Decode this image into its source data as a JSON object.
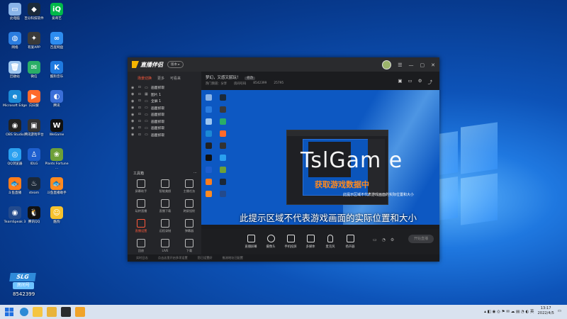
{
  "desktop": {
    "icons": [
      {
        "label": "此电脑",
        "color": "#8ab4e8",
        "glyph": "▭"
      },
      {
        "label": "百分科技软件",
        "color": "#1b2a3a",
        "glyph": "◆"
      },
      {
        "label": "爱奇艺",
        "color": "#00b84a",
        "glyph": "iQ"
      },
      {
        "label": "网络",
        "color": "#2b7de0",
        "glyph": "◍"
      },
      {
        "label": "有爱APP",
        "color": "#3a3a3a",
        "glyph": "✦"
      },
      {
        "label": "百度网盘",
        "color": "#2d8cf0",
        "glyph": "∞"
      },
      {
        "label": "回收站",
        "color": "#9ec6f0",
        "glyph": "🗑"
      },
      {
        "label": "微信",
        "color": "#2aae67",
        "glyph": "✉"
      },
      {
        "label": "酷狗音乐",
        "color": "#1f7ae0",
        "glyph": "K"
      },
      {
        "label": "Microsoft Edge",
        "color": "#1b8ad6",
        "glyph": "e"
      },
      {
        "label": "向日葵",
        "color": "#ff6a2b",
        "glyph": "▶"
      },
      {
        "label": "腾讯",
        "color": "#3b6fd8",
        "glyph": "◐"
      },
      {
        "label": "OBS Studio",
        "color": "#222",
        "glyph": "◉"
      },
      {
        "label": "腾讯游戏平台",
        "color": "#333",
        "glyph": "▣"
      },
      {
        "label": "WeGame",
        "color": "#111",
        "glyph": "W"
      },
      {
        "label": "QQ浏览器",
        "color": "#2aa0f0",
        "glyph": "◎"
      },
      {
        "label": "IDLG",
        "color": "#1e5fcf",
        "glyph": "♙"
      },
      {
        "label": "Plants Fortune ...",
        "color": "#6ea038",
        "glyph": "❀"
      },
      {
        "label": "斗鱼直播",
        "color": "#ff7d1a",
        "glyph": "🐟"
      },
      {
        "label": "steam",
        "color": "#1b2838",
        "glyph": "♨"
      },
      {
        "label": "斗鱼直播助手",
        "color": "#ff8a1f",
        "glyph": "🐟"
      },
      {
        "label": "TeamSpeak 3",
        "color": "#234a8c",
        "glyph": "◉"
      },
      {
        "label": "腾讯QQ",
        "color": "#111",
        "glyph": "🐧"
      },
      {
        "label": "酷狗",
        "color": "#f6c22d",
        "glyph": "☺"
      }
    ]
  },
  "app": {
    "title": "直播伴侣",
    "version_label": "版本 ▸",
    "left_tabs": [
      "场景切换",
      "更多",
      "可看来"
    ],
    "scenes": [
      {
        "name": "画面抓取"
      },
      {
        "name": "图片 1"
      },
      {
        "name": "全屏 1"
      },
      {
        "name": "画面抓取"
      },
      {
        "name": "画面抓取"
      },
      {
        "name": "画面抓取"
      },
      {
        "name": "画面抓取"
      },
      {
        "name": "画面抓取"
      }
    ],
    "toolbox_label": "工具箱",
    "tools": [
      {
        "label": "屏幕助手"
      },
      {
        "label": "智能美颜"
      },
      {
        "label": "主播任务"
      },
      {
        "label": "玩转直播"
      },
      {
        "label": "直播下载"
      },
      {
        "label": "跨屏投射"
      },
      {
        "label": "直播设置"
      },
      {
        "label": "远程录制"
      },
      {
        "label": "弹幕器"
      },
      {
        "label": "回放"
      },
      {
        "label": "LIVE"
      },
      {
        "label": "下载"
      }
    ],
    "room_title": "梦幻，又感又腻玩！",
    "edit_label": "修改",
    "room_meta": [
      "热门频道：分享",
      "房间号码",
      "8542399",
      "25795"
    ],
    "bottom_buttons": [
      "直播屏幕",
      "摄像头",
      "手机投屏",
      "多媒体",
      "麦克风",
      "扬声器"
    ],
    "start_live_label": "开始直播",
    "statusbar": [
      "实时日志",
      "点击这里开启多项设置",
      "您已设置好",
      "推流地址已配置"
    ]
  },
  "preview": {
    "watermark_big": "TslGam e",
    "watermark_orange": "获取游戏数据中",
    "watermark_small": "此提示区域不代表游戏画面的实际位置和大小",
    "caption": "此提示区域不代表游戏画面的实际位置和大小"
  },
  "badge": {
    "brand_line1": "SLG",
    "brand_line2": "房间号",
    "room_id": "8542399"
  },
  "taskbar": {
    "time": "13:17",
    "date": "2022/4/5"
  }
}
